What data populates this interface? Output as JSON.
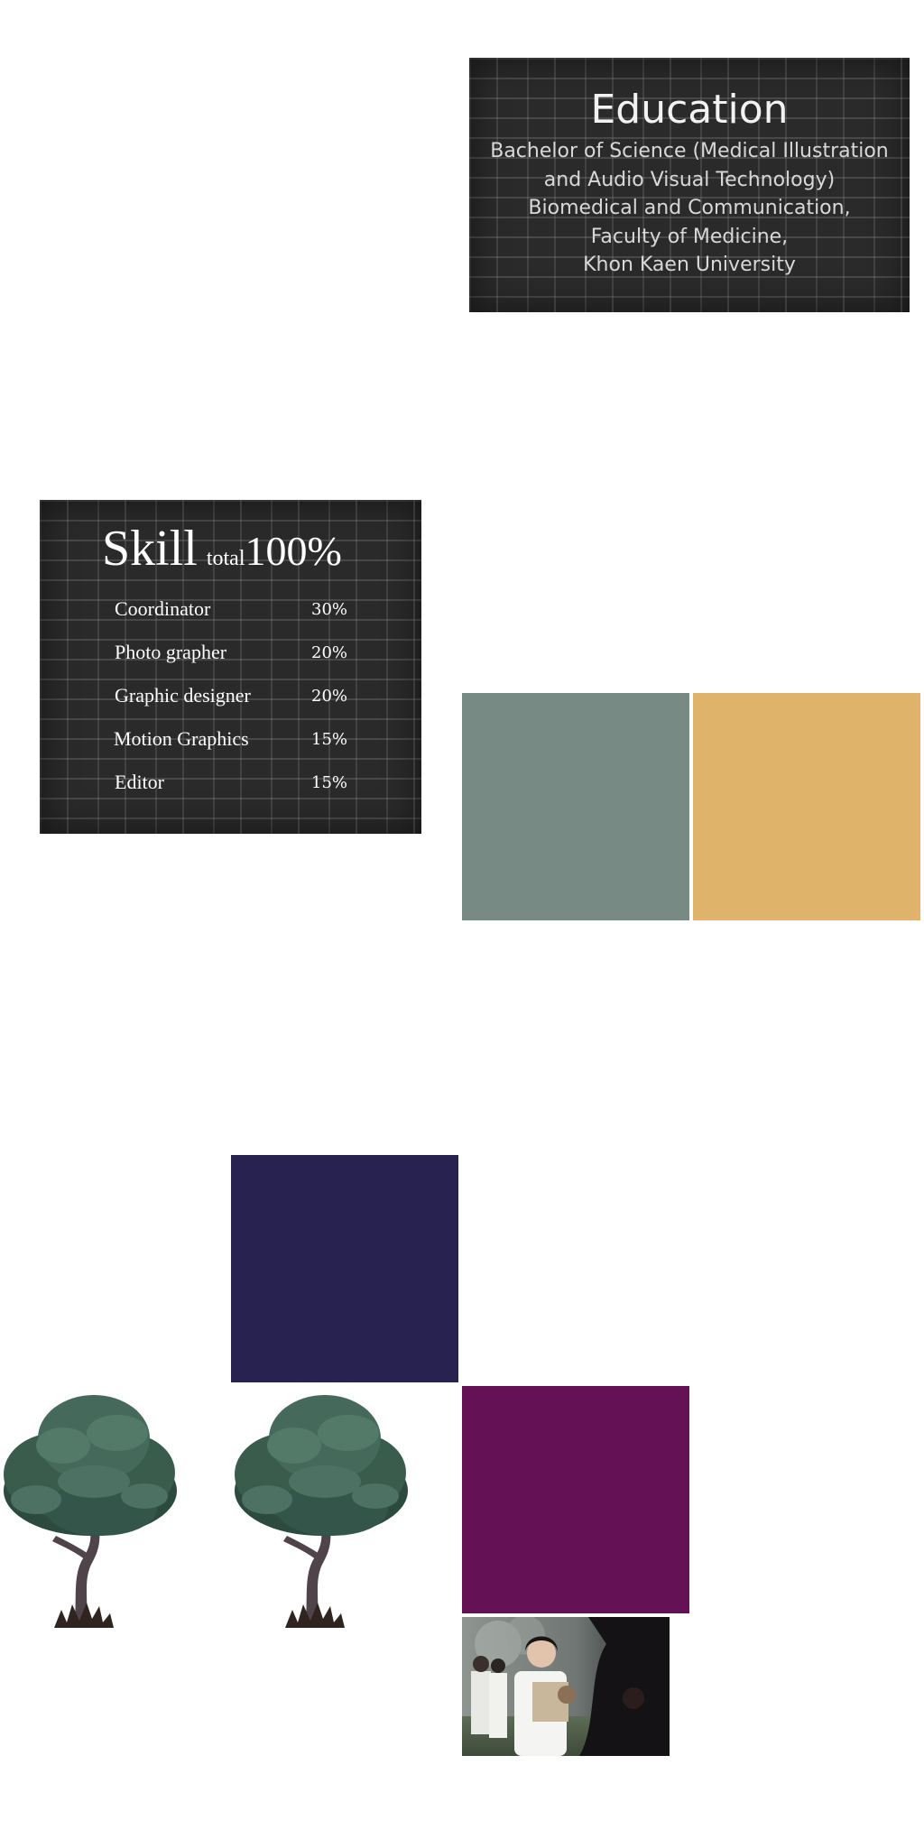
{
  "education": {
    "title": "Education",
    "lines": [
      "Bachelor of Science (Medical Illustration",
      "and Audio Visual Technology)",
      "Biomedical and Communication,",
      "Faculty of Medicine,",
      "Khon Kaen University"
    ]
  },
  "skill": {
    "title": "Skill",
    "total_label": "total",
    "total_value": "100%",
    "items": [
      {
        "name": "Coordinator",
        "value": "30%"
      },
      {
        "name": "Photo grapher",
        "value": "20%"
      },
      {
        "name": "Graphic designer",
        "value": "20%"
      },
      {
        "name": "Motion Graphics",
        "value": "15%"
      },
      {
        "name": "Editor",
        "value": "15%"
      }
    ]
  },
  "palette": {
    "gray": "#778a83",
    "gold": "#e0b36a",
    "navy": "#282251",
    "purple": "#651156"
  }
}
